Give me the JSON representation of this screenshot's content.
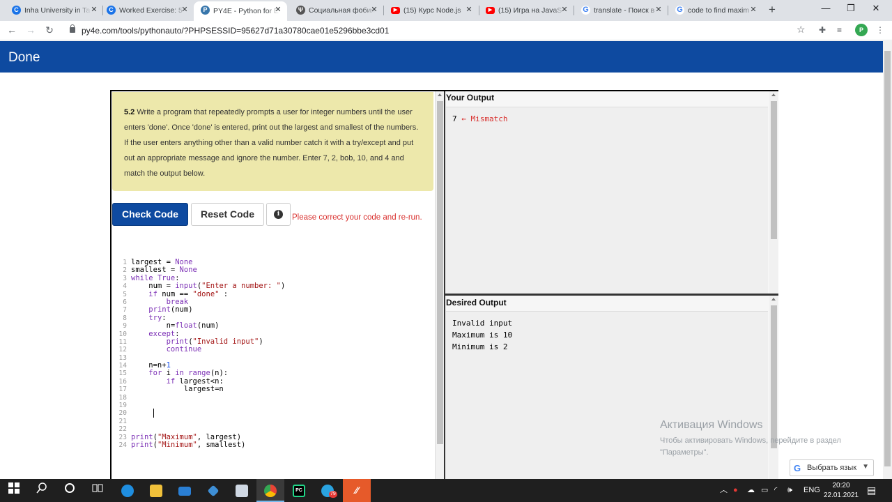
{
  "browser": {
    "tabs": [
      {
        "title": "Inha University in Ta",
        "icon": "c-icon",
        "color": "#1a73e8"
      },
      {
        "title": "Worked Exercise: 5",
        "icon": "c-icon",
        "color": "#1a73e8"
      },
      {
        "title": "PY4E - Python for E",
        "icon": "python-icon",
        "color": "#3776ab"
      },
      {
        "title": "Социальная фобия",
        "icon": "psi-icon",
        "color": "#444444"
      },
      {
        "title": "(15) Курс Node.js",
        "icon": "youtube-icon",
        "color": "#ff0000"
      },
      {
        "title": "(15) Игра на JavaS",
        "icon": "youtube-icon",
        "color": "#ff0000"
      },
      {
        "title": "translate - Поиск в",
        "icon": "google-icon",
        "color": "#4285f4"
      },
      {
        "title": "code to find maxim",
        "icon": "google-icon",
        "color": "#4285f4"
      }
    ],
    "active_tab_index": 2,
    "url": "py4e.com/tools/pythonauto/?PHPSESSID=95627d71a30780cae01e5296bbe3cd01",
    "profile_initial": "P"
  },
  "page": {
    "banner_title": "Done",
    "problem": {
      "number": "5.2",
      "text": "Write a program that repeatedly prompts a user for integer numbers until the user enters 'done'. Once 'done' is entered, print out the largest and smallest of the numbers. If the user enters anything other than a valid number catch it with a try/except and put out an appropriate message and ignore the number. Enter 7, 2, bob, 10, and 4 and match the output below."
    },
    "buttons": {
      "check": "Check Code",
      "reset": "Reset Code",
      "info": "i"
    },
    "error_message": "Please correct your code and re-run.",
    "code_lines": [
      "largest = None",
      "smallest = None",
      "while True:",
      "    num = input(\"Enter a number: \")",
      "    if num == \"done\" :",
      "        break",
      "    print(num)",
      "    try:",
      "        n=float(num)",
      "    except:",
      "        print(\"Invalid input\")",
      "        continue",
      "",
      "    n=n+1",
      "    for i in range(n):",
      "        if largest<n:",
      "            largest=n",
      "",
      "",
      "",
      "",
      "",
      "print(\"Maximum\", largest)",
      "print(\"Minimum\", smallest)"
    ],
    "your_output": {
      "header": "Your Output",
      "lines": [
        {
          "value": "7",
          "note": "← Mismatch"
        }
      ]
    },
    "desired_output": {
      "header": "Desired Output",
      "lines": [
        "Invalid input",
        "Maximum is 10",
        "Minimum is 2"
      ]
    },
    "watermark": {
      "title": "Активация Windows",
      "text": "Чтобы активировать Windows, перейдите в раздел \"Параметры\"."
    },
    "translate_widget": "Выбрать язык"
  },
  "taskbar": {
    "language": "ENG",
    "time": "20:20",
    "date": "22.01.2021",
    "telegram_badge": "79"
  },
  "colors": {
    "banner": "#0e4aa0",
    "problem_bg": "#ede8ab",
    "error": "#d9302e"
  }
}
